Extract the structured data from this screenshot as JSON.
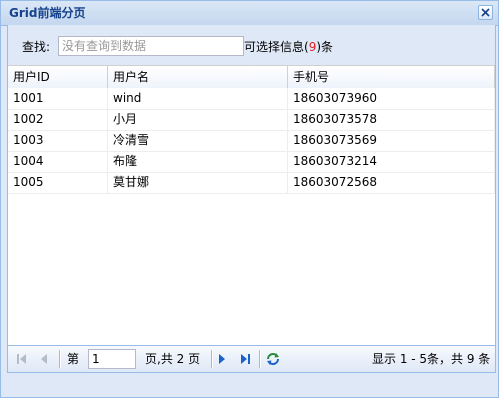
{
  "window": {
    "title": "Grid前端分页"
  },
  "search": {
    "label": "查找:",
    "placeholder": "没有查询到数据",
    "value": "",
    "count_prefix": "可选择信息(",
    "count_value": "9",
    "count_suffix": ")条"
  },
  "grid": {
    "columns": [
      "用户ID",
      "用户名",
      "手机号"
    ],
    "rows": [
      [
        "1001",
        "wind",
        "18603073960"
      ],
      [
        "1002",
        "小月",
        "18603073578"
      ],
      [
        "1003",
        "冷清雪",
        "18603073569"
      ],
      [
        "1004",
        "布隆",
        "18603073214"
      ],
      [
        "1005",
        "莫甘娜",
        "18603072568"
      ]
    ]
  },
  "pager": {
    "page_prefix": "第",
    "current_page": "1",
    "page_suffix": "页,共 2 页",
    "display_info": "显示 1 - 5条，共 9 条"
  },
  "colors": {
    "accent": "#15428b",
    "border": "#99bbe8",
    "background": "#dfe8f6",
    "count_highlight": "#e02020"
  },
  "icons": [
    "close-icon",
    "first-page-icon",
    "prev-page-icon",
    "next-page-icon",
    "last-page-icon",
    "refresh-icon"
  ]
}
